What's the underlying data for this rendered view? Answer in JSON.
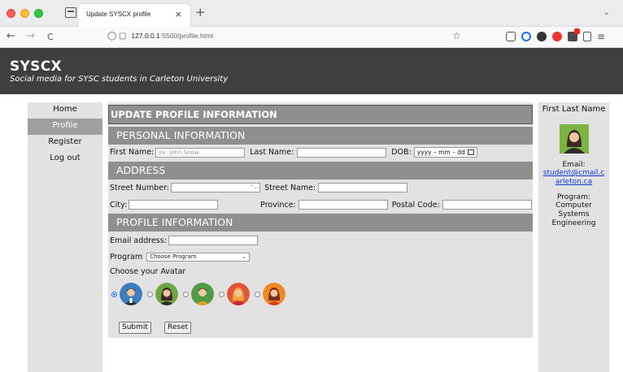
{
  "browser": {
    "tab_title": "Update SYSCX profile",
    "tab_close": "×",
    "new_tab": "+",
    "url_host": "127.0.0.1",
    "url_rest": ":5500/profile.html"
  },
  "site": {
    "title": "SYSCX",
    "tagline": "Social media for SYSC students in Carleton University"
  },
  "nav": {
    "items": [
      {
        "label": "Home"
      },
      {
        "label": "Profile"
      },
      {
        "label": "Register"
      },
      {
        "label": "Log out"
      }
    ]
  },
  "form": {
    "page_title": "UPDATE PROFILE INFORMATION",
    "personal_heading": "PERSONAL INFORMATION",
    "first_name_label": "First Name:",
    "first_name_placeholder": "ex: John Snow",
    "last_name_label": "Last Name:",
    "dob_label": "DOB:",
    "dob_placeholder": "yyyy – mm – dd",
    "address_heading": "ADDRESS",
    "street_number_label": "Street Number:",
    "street_name_label": "Street Name:",
    "city_label": "City:",
    "province_label": "Province:",
    "postal_code_label": "Postal Code:",
    "profile_heading": "PROFILE INFORMATION",
    "email_label": "Email address:",
    "program_label": "Program",
    "program_selected": "Choose Program",
    "avatar_label": "Choose your Avatar",
    "submit_label": "Submit",
    "reset_label": "Reset"
  },
  "aside": {
    "name": "First Last Name",
    "email_label": "Email:",
    "email": "student@cmail.carleton.ca",
    "program_label": "Program:",
    "program": "Computer Systems Engineering"
  },
  "icons": {
    "back": "←",
    "forward": "→",
    "reload": "C",
    "star": "☆",
    "chevron": "⌄",
    "spinner": "⌃⌄"
  },
  "colors": {
    "header_bg": "#3f3f3f",
    "panel_bg": "#e2e2e2",
    "section_bar": "#8f8f8f",
    "active_nav": "#9f9f9f",
    "link": "#0b3bd1"
  }
}
